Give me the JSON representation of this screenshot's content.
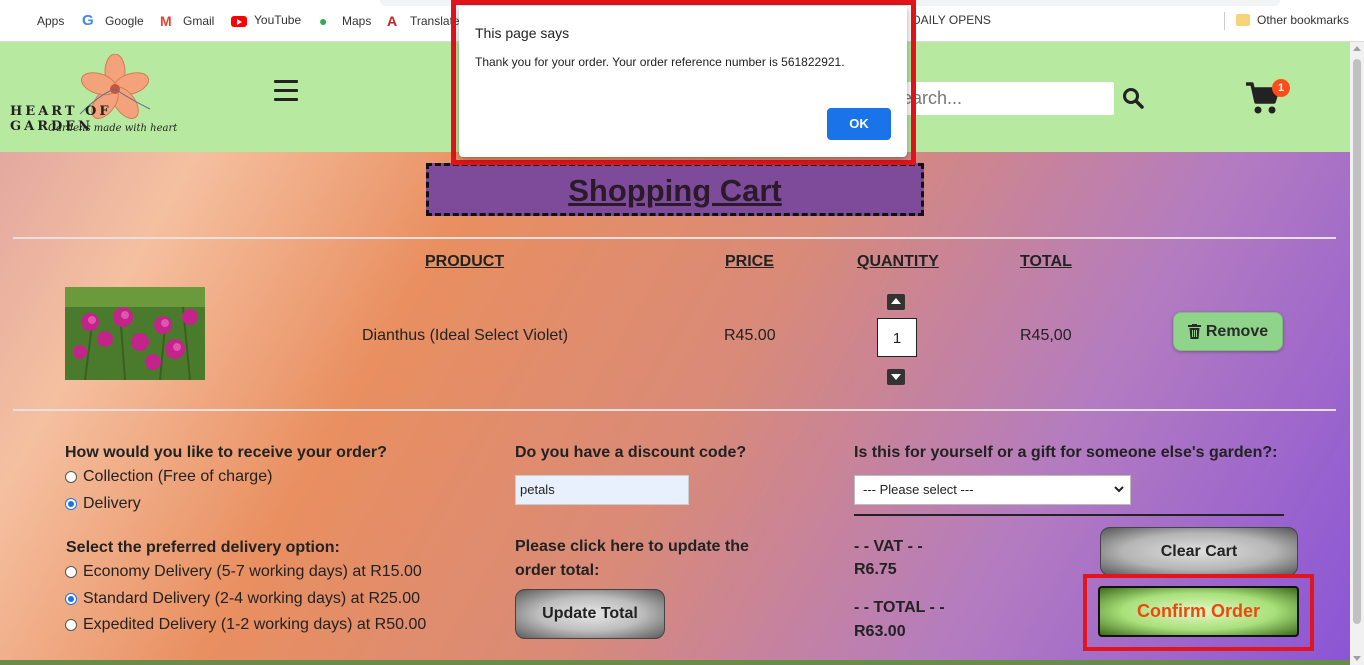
{
  "bookmarks": {
    "items": [
      {
        "label": "Apps",
        "icon": "apps-icon"
      },
      {
        "label": "Google",
        "icon": "google-icon"
      },
      {
        "label": "Gmail",
        "icon": "gmail-icon"
      },
      {
        "label": "YouTube",
        "icon": "youtube-icon"
      },
      {
        "label": "Maps",
        "icon": "maps-icon"
      },
      {
        "label": "Translate",
        "icon": "translate-icon"
      },
      {
        "label": "DAILY OPENS",
        "icon": ""
      }
    ],
    "other": "Other bookmarks"
  },
  "site": {
    "brand": "HEART OF GARDEN",
    "tagline": "Gardens made with heart",
    "search_placeholder": "Search...",
    "cart_count": "1",
    "brand_color": "#b7e9a1"
  },
  "cart": {
    "title": "Shopping Cart",
    "columns": {
      "product": "PRODUCT",
      "price": "PRICE",
      "quantity": "QUANTITY",
      "total": "TOTAL"
    },
    "item": {
      "name": "Dianthus (Ideal Select Violet)",
      "price": "R45.00",
      "quantity": "1",
      "total": "R45,00",
      "remove_label": "Remove"
    }
  },
  "receive": {
    "question": "How would you like to receive your order?",
    "options": [
      {
        "label": "Collection (Free of charge)",
        "checked": false
      },
      {
        "label": "Delivery",
        "checked": true
      }
    ]
  },
  "delivery": {
    "question": "Select the preferred delivery option:",
    "options": [
      {
        "label": "Economy Delivery (5-7 working days) at R15.00",
        "checked": false
      },
      {
        "label": "Standard Delivery (2-4 working days) at R25.00",
        "checked": true
      },
      {
        "label": "Expedited Delivery (1-2 working days) at R50.00",
        "checked": false
      }
    ]
  },
  "discount": {
    "question": "Do you have a discount code?",
    "value": "petals",
    "update_text": "Please click here to update the order total:",
    "update_button": "Update Total"
  },
  "gift": {
    "question": "Is this for yourself or a gift for someone else's garden?:",
    "selected": "--- Please select ---"
  },
  "summary": {
    "vat_label": "- - VAT - -",
    "vat_value": "R6.75",
    "total_label": "- - TOTAL - -",
    "total_value": "R63.00",
    "clear_button": "Clear Cart",
    "confirm_button": "Confirm Order"
  },
  "dialog": {
    "title": "This page says",
    "message": "Thank you for your order. Your order reference number is 561822921.",
    "ok": "OK"
  }
}
